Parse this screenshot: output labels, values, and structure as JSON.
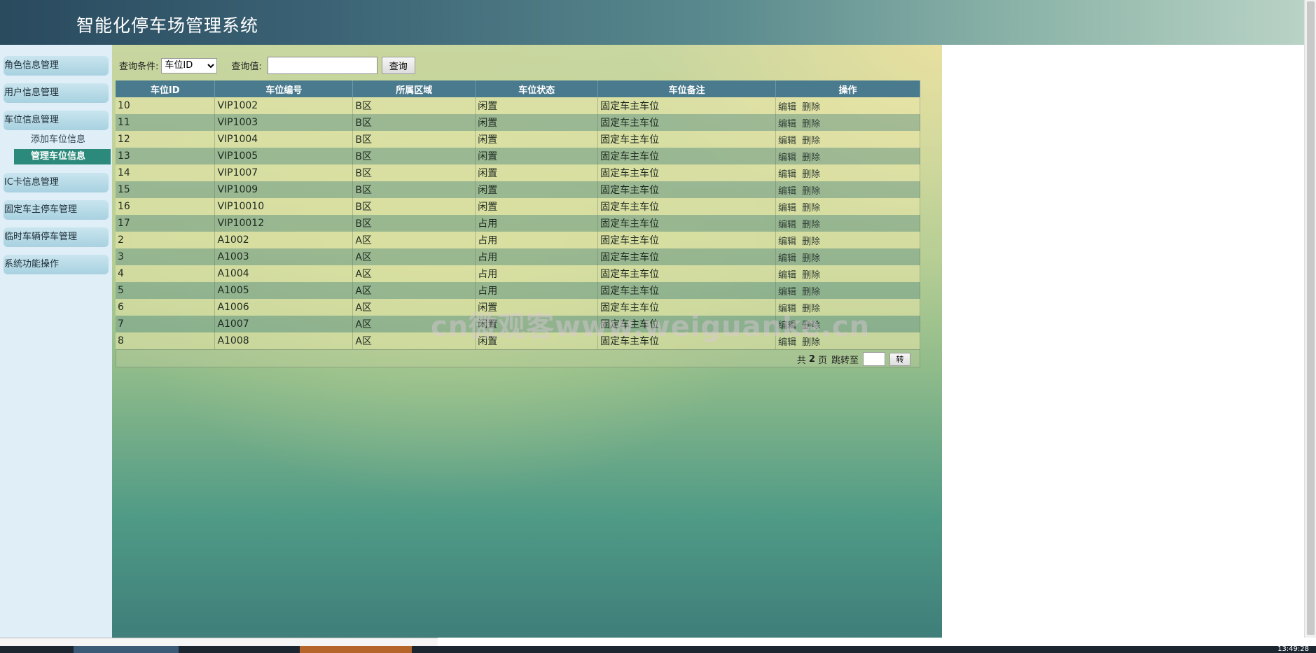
{
  "app": {
    "title": "智能化停车场管理系统"
  },
  "sidebar": {
    "items": [
      {
        "label": "角色信息管理"
      },
      {
        "label": "用户信息管理"
      },
      {
        "label": "车位信息管理"
      },
      {
        "label": "IC卡信息管理"
      },
      {
        "label": "固定车主停车管理"
      },
      {
        "label": "临时车辆停车管理"
      },
      {
        "label": "系统功能操作"
      }
    ],
    "sub_items": [
      {
        "label": "添加车位信息"
      },
      {
        "label": "管理车位信息"
      }
    ]
  },
  "search": {
    "condition_label": "查询条件:",
    "condition_value": "车位ID",
    "value_label": "查询值:",
    "value_input": "",
    "button_label": "查询"
  },
  "table": {
    "columns": [
      "车位ID",
      "车位编号",
      "所属区域",
      "车位状态",
      "车位备注",
      "操作"
    ],
    "rows": [
      {
        "id": "10",
        "code": "VIP1002",
        "area": "B区",
        "status": "闲置",
        "note": "固定车主车位"
      },
      {
        "id": "11",
        "code": "VIP1003",
        "area": "B区",
        "status": "闲置",
        "note": "固定车主车位"
      },
      {
        "id": "12",
        "code": "VIP1004",
        "area": "B区",
        "status": "闲置",
        "note": "固定车主车位"
      },
      {
        "id": "13",
        "code": "VIP1005",
        "area": "B区",
        "status": "闲置",
        "note": "固定车主车位"
      },
      {
        "id": "14",
        "code": "VIP1007",
        "area": "B区",
        "status": "闲置",
        "note": "固定车主车位"
      },
      {
        "id": "15",
        "code": "VIP1009",
        "area": "B区",
        "status": "闲置",
        "note": "固定车主车位"
      },
      {
        "id": "16",
        "code": "VIP10010",
        "area": "B区",
        "status": "闲置",
        "note": "固定车主车位"
      },
      {
        "id": "17",
        "code": "VIP10012",
        "area": "B区",
        "status": "占用",
        "note": "固定车主车位"
      },
      {
        "id": "2",
        "code": "A1002",
        "area": "A区",
        "status": "占用",
        "note": "固定车主车位"
      },
      {
        "id": "3",
        "code": "A1003",
        "area": "A区",
        "status": "占用",
        "note": "固定车主车位"
      },
      {
        "id": "4",
        "code": "A1004",
        "area": "A区",
        "status": "占用",
        "note": "固定车主车位"
      },
      {
        "id": "5",
        "code": "A1005",
        "area": "A区",
        "status": "占用",
        "note": "固定车主车位"
      },
      {
        "id": "6",
        "code": "A1006",
        "area": "A区",
        "status": "闲置",
        "note": "固定车主车位"
      },
      {
        "id": "7",
        "code": "A1007",
        "area": "A区",
        "status": "闲置",
        "note": "固定车主车位"
      },
      {
        "id": "8",
        "code": "A1008",
        "area": "A区",
        "status": "闲置",
        "note": "固定车主车位"
      }
    ],
    "edit_label": "编辑",
    "delete_label": "删除"
  },
  "pager": {
    "total_prefix": "共",
    "total_pages": "2",
    "total_suffix": "页",
    "jump_label": "跳转至",
    "go_label": "转"
  },
  "watermark": "cn微观客www.weiguanke.cn",
  "clock": "13:49:28",
  "colors": {
    "header_dark": "#2a4a5e",
    "table_header": "#4a7a8d",
    "active_submenu": "#2b8a7b"
  }
}
